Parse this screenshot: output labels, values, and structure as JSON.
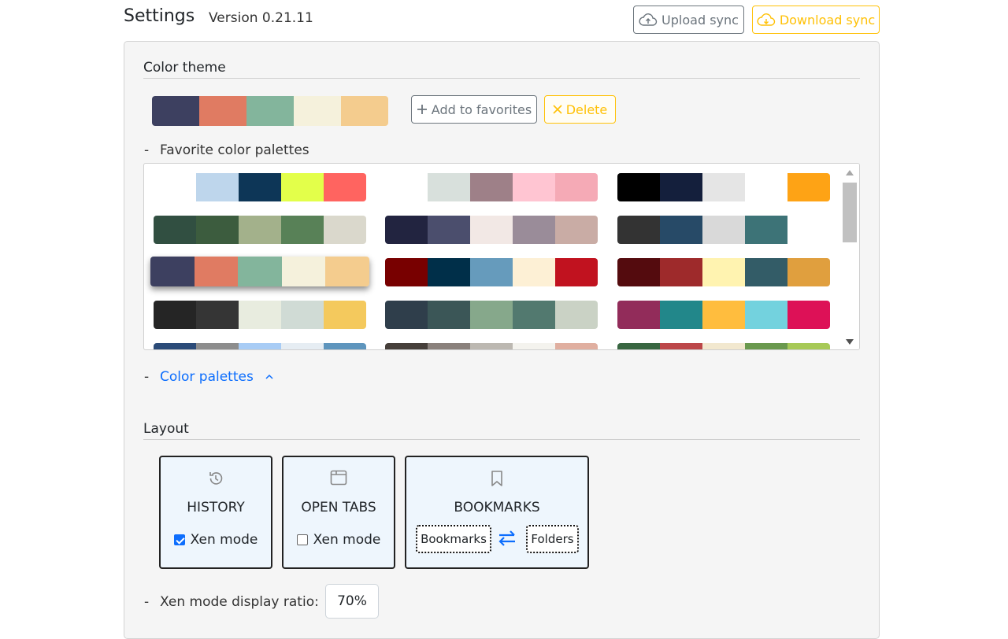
{
  "header": {
    "title": "Settings",
    "version": "Version 0.21.11",
    "upload_label": "Upload sync",
    "download_label": "Download sync"
  },
  "color_theme": {
    "section_title": "Color theme",
    "current_palette": [
      "#3d4060",
      "#e07b62",
      "#83b59c",
      "#f5f1dc",
      "#f4cc8e"
    ],
    "add_favorite_label": "Add to favorites",
    "delete_label": "Delete",
    "favorites_label": "Favorite color palettes",
    "favorites": [
      [
        "#ffffff",
        "#bed6ec",
        "#0d3657",
        "#e3ff4a",
        "#ff6460"
      ],
      [
        "#ffffff",
        "#d8e0dc",
        "#9e8088",
        "#ffc5d2",
        "#f5aab6"
      ],
      [
        "#000000",
        "#141f3c",
        "#e5e5e5",
        "#ffffff",
        "#fea315"
      ],
      [
        "#314f41",
        "#3c5c3e",
        "#a3b18b",
        "#588157",
        "#dad8cc"
      ],
      [
        "#222440",
        "#4b4e6d",
        "#f2e8e5",
        "#9a8c99",
        "#c9aca5"
      ],
      [
        "#333333",
        "#274a67",
        "#d9d9d9",
        "#3d7377",
        "#ffffff"
      ],
      [
        "#3d4060",
        "#e07b62",
        "#83b59c",
        "#f5f1dc",
        "#f4cc8e"
      ],
      [
        "#780000",
        "#002f49",
        "#669bbc",
        "#fdf0d5",
        "#c1121f"
      ],
      [
        "#540b0e",
        "#9e2a2b",
        "#fff3b0",
        "#335c67",
        "#e09f3e"
      ],
      [
        "#252525",
        "#353535",
        "#e8ecdf",
        "#d0dbd5",
        "#f4c95d"
      ],
      [
        "#2f3e4b",
        "#3b5657",
        "#86a88b",
        "#52796f",
        "#cad2c5"
      ],
      [
        "#922c5a",
        "#22878a",
        "#ffbd3e",
        "#73d2de",
        "#dd1157"
      ],
      [
        "#2b4b78",
        "#8d8d8d",
        "#a8ccf5",
        "#e6edf3",
        "#5e95bd"
      ],
      [
        "#463f3a",
        "#8a817c",
        "#bcb8b1",
        "#f4f3ee",
        "#e0afa0"
      ],
      [
        "#386641",
        "#bc4749",
        "#f2e8cf",
        "#6a994e",
        "#a7c957"
      ]
    ],
    "selected_index": 6,
    "palettes_link": "Color palettes"
  },
  "layout": {
    "section_title": "Layout",
    "history": {
      "title": "HISTORY",
      "xen_label": "Xen mode",
      "xen_checked": true
    },
    "open_tabs": {
      "title": "OPEN TABS",
      "xen_label": "Xen mode",
      "xen_checked": false
    },
    "bookmarks": {
      "title": "BOOKMARKS",
      "option_a": "Bookmarks",
      "option_b": "Folders"
    },
    "ratio_label": "Xen mode display ratio:",
    "ratio_value": "70%"
  },
  "colors": {
    "secondary": "#6c757d",
    "warning": "#ffc107",
    "primary": "#0d6efd"
  }
}
